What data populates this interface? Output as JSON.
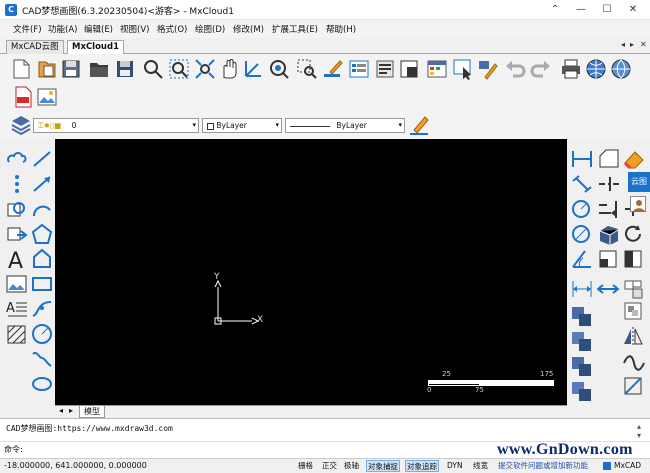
{
  "window": {
    "title": "CAD梦想画图(6.3.20230504)<游客> - MxCloud1",
    "minimize": "—",
    "maximize": "☐",
    "close": "✕",
    "restore": "⌃"
  },
  "menu": [
    "文件(F)",
    "功能(A)",
    "编辑(E)",
    "视图(V)",
    "格式(O)",
    "绘图(D)",
    "修改(M)",
    "扩展工具(E)",
    "帮助(H)"
  ],
  "tabs": {
    "items": [
      "MxCAD云图",
      "MxCloud1"
    ],
    "active": 1,
    "ctrl_left": "◂",
    "ctrl_right": "▸",
    "ctrl_close": "✕"
  },
  "layer": {
    "value": "0"
  },
  "color": {
    "value": "ByLayer"
  },
  "linetype": {
    "value": "ByLayer"
  },
  "canvas": {
    "axis_y": "Y",
    "axis_x": "X",
    "scale_25": "25",
    "scale_175": "175",
    "scale_0": "0",
    "scale_75": "75"
  },
  "layout_tabs": {
    "model": "模型"
  },
  "command": {
    "line1": "CAD梦想画图:https://www.mxdraw3d.com",
    "prompt": "命令:"
  },
  "status": {
    "coords": "-18.000000, 641.000000, 0.000000",
    "items": [
      "栅格",
      "正交",
      "极轴",
      "对象捕捉",
      "对象追踪",
      "DYN",
      "线宽"
    ],
    "on": [
      false,
      false,
      false,
      true,
      true,
      false,
      false
    ],
    "link": "提交软件问题或增加新功能",
    "brand": "MxCAD"
  },
  "side_panel": {
    "tab1": "云图"
  },
  "watermark": "www.GnDown.com",
  "colors": {
    "accent": "#1a73c8",
    "canvas": "#000000"
  }
}
